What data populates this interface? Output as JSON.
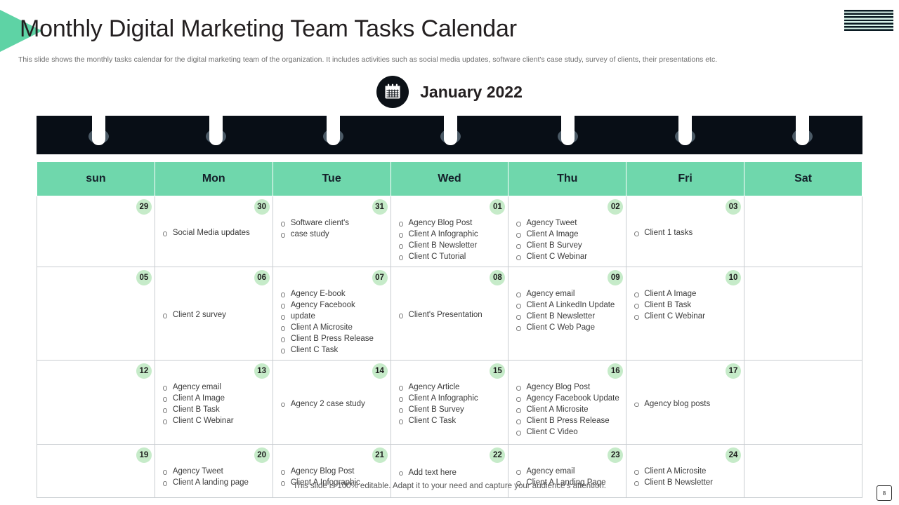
{
  "header": {
    "title": "Monthly Digital Marketing Team Tasks Calendar",
    "subtitle": "This slide shows the monthly tasks calendar for the digital marketing team of the organization. It includes activities such as social media  updates, software client's case study, survey of clients, their presentations etc.",
    "logo_icon": "striped-logo-icon"
  },
  "month": {
    "icon": "calendar-icon",
    "label": "January 2022"
  },
  "calendar": {
    "weekday_headers": [
      "sun",
      "Mon",
      "Tue",
      "Wed",
      "Thu",
      "Fri",
      "Sat"
    ],
    "weeks": [
      [
        {
          "date": "29",
          "tasks": []
        },
        {
          "date": "30",
          "tasks": [
            "Social Media  updates"
          ]
        },
        {
          "date": "31",
          "tasks": [
            "Software  client's",
            "case study"
          ]
        },
        {
          "date": "01",
          "tasks": [
            "Agency Blog Post",
            "Client  A Infographic",
            "Client  B Newsletter",
            "Client  C Tutorial"
          ]
        },
        {
          "date": "02",
          "tasks": [
            "Agency Tweet",
            "Client  A Image",
            "Client  B Survey",
            "Client  C Webinar"
          ]
        },
        {
          "date": "03",
          "tasks": [
            "Client  1 tasks"
          ]
        },
        {
          "date": "",
          "tasks": []
        }
      ],
      [
        {
          "date": "05",
          "tasks": []
        },
        {
          "date": "06",
          "tasks": [
            "Client  2 survey"
          ]
        },
        {
          "date": "07",
          "tasks": [
            "Agency E-book",
            "Agency Facebook",
            "update",
            "Client  A Microsite",
            "Client  B Press Release",
            "Client  C Task"
          ]
        },
        {
          "date": "08",
          "tasks": [
            "Client's Presentation"
          ]
        },
        {
          "date": "09",
          "tasks": [
            "Agency email",
            "Client  A LinkedIn Update",
            "Client  B Newsletter",
            "Client  C Web Page"
          ]
        },
        {
          "date": "10",
          "tasks": [
            "Client  A Image",
            "Client  B Task",
            "Client  C Webinar"
          ]
        },
        {
          "date": "",
          "tasks": []
        }
      ],
      [
        {
          "date": "12",
          "tasks": []
        },
        {
          "date": "13",
          "tasks": [
            "Agency email",
            "Client  A Image",
            "Client  B Task",
            "Client  C Webinar"
          ]
        },
        {
          "date": "14",
          "tasks": [
            "Agency 2 case study"
          ]
        },
        {
          "date": "15",
          "tasks": [
            "Agency Article",
            "Client  A Infographic",
            "Client  B Survey",
            "Client  C Task"
          ]
        },
        {
          "date": "16",
          "tasks": [
            "Agency Blog Post",
            "Agency Facebook Update",
            "Client  A Microsite",
            "Client  B Press Release",
            "Client  C Video"
          ]
        },
        {
          "date": "17",
          "tasks": [
            "Agency blog posts"
          ]
        },
        {
          "date": "",
          "tasks": []
        }
      ],
      [
        {
          "date": "19",
          "tasks": []
        },
        {
          "date": "20",
          "tasks": [
            "Agency Tweet",
            "Client  A landing page"
          ]
        },
        {
          "date": "21",
          "tasks": [
            "Agency Blog Post",
            "Client  A Infographic"
          ]
        },
        {
          "date": "22",
          "tasks": [
            "Add text here"
          ]
        },
        {
          "date": "23",
          "tasks": [
            "Agency email",
            "Client  A Landing  Page"
          ]
        },
        {
          "date": "24",
          "tasks": [
            "Client  A Microsite",
            "Client  B Newsletter"
          ]
        },
        {
          "date": "",
          "tasks": []
        }
      ]
    ]
  },
  "footer": {
    "note": "This slide is 100% editable. Adapt it to your need and capture your audience's attention.",
    "page_number": "8"
  },
  "colors": {
    "accent_green": "#6fd7ac",
    "badge_green": "#c6ebc9",
    "binder_dark": "#080e16",
    "text_dark": "#231f20"
  }
}
